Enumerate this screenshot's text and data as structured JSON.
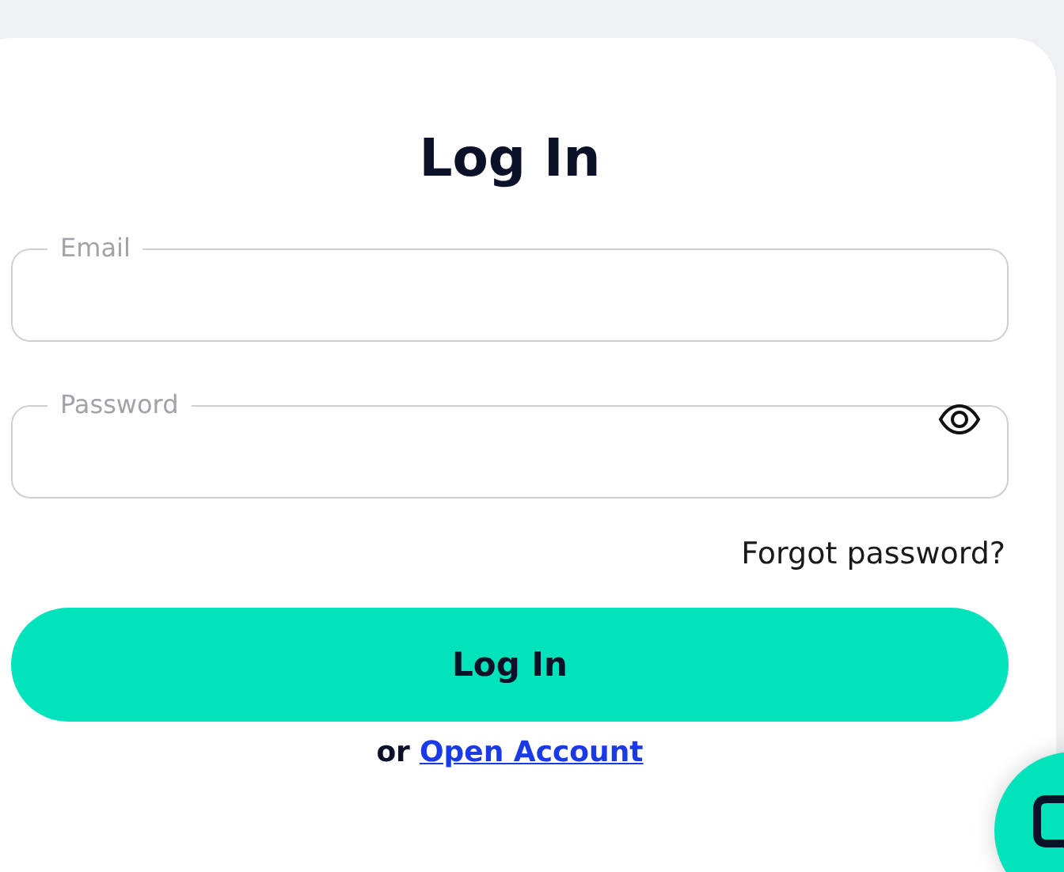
{
  "title": "Log In",
  "fields": [
    {
      "label": "Email",
      "kind": "text"
    },
    {
      "label": "Password",
      "kind": "password"
    }
  ],
  "forgot_link": "Forgot password?",
  "submit": "Log In",
  "signup": {
    "prefix": "or",
    "link": "Open Account"
  }
}
